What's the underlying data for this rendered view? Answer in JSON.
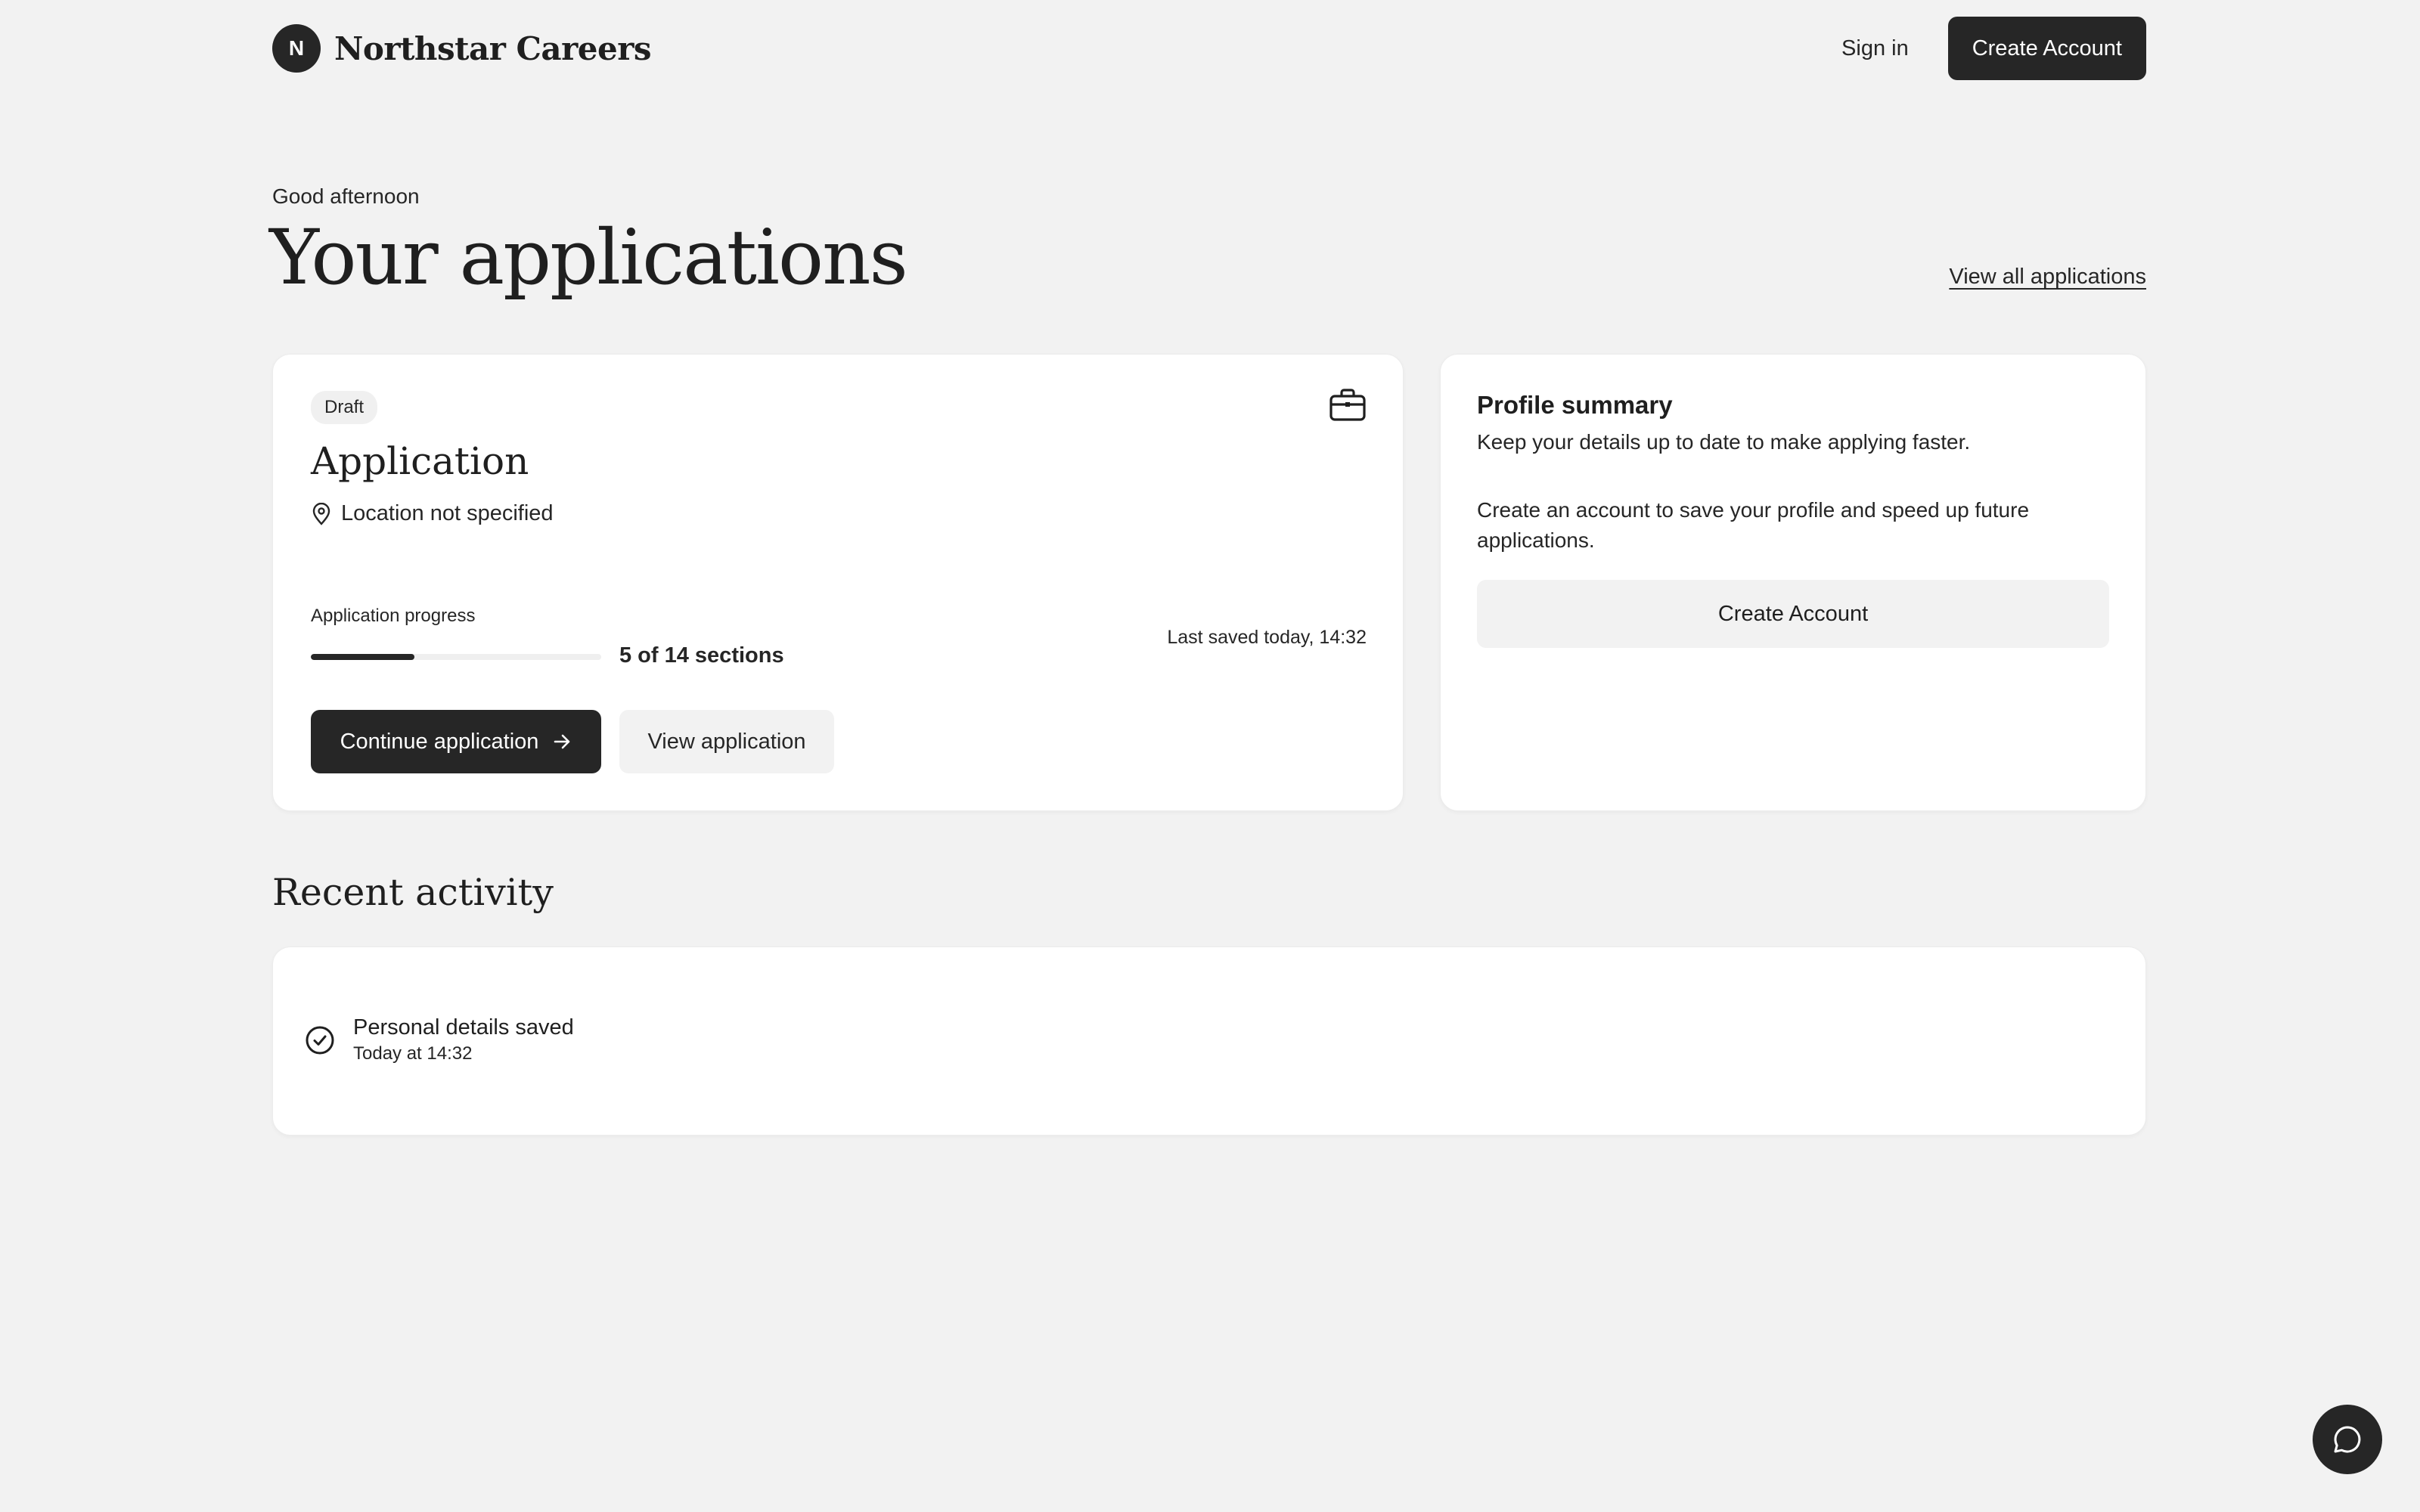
{
  "header": {
    "logo_letter": "N",
    "brand_name": "Northstar Careers",
    "sign_in_label": "Sign in",
    "create_account_label": "Create Account"
  },
  "hero": {
    "greeting": "Good afternoon",
    "title": "Your applications",
    "view_all_label": "View all applications"
  },
  "application_card": {
    "status_badge": "Draft",
    "icon": "briefcase-icon",
    "title": "Application",
    "location": "Location not specified",
    "location_icon": "map-pin-icon",
    "progress_label": "Application progress",
    "progress": {
      "completed": 5,
      "total": 14,
      "fraction": 0.357
    },
    "progress_text": "5 of 14 sections",
    "last_saved": "Last saved today, 14:32",
    "continue_label": "Continue application",
    "continue_icon": "arrow-right-icon",
    "view_label": "View application"
  },
  "profile_card": {
    "title": "Profile summary",
    "subtitle": "Keep your details up to date to make applying faster.",
    "description": "Create an account to save your profile and speed up future applications.",
    "create_account_label": "Create Account"
  },
  "recent_activity": {
    "title": "Recent activity",
    "items": [
      {
        "icon": "check-circle-icon",
        "title": "Personal details saved",
        "time": "Today at 14:32"
      }
    ]
  },
  "chat": {
    "icon": "chat-bubble-icon"
  },
  "colors": {
    "background": "#f2f2f2",
    "surface": "#ffffff",
    "primary_dark": "#262626",
    "secondary_button": "#f2f2f2"
  }
}
